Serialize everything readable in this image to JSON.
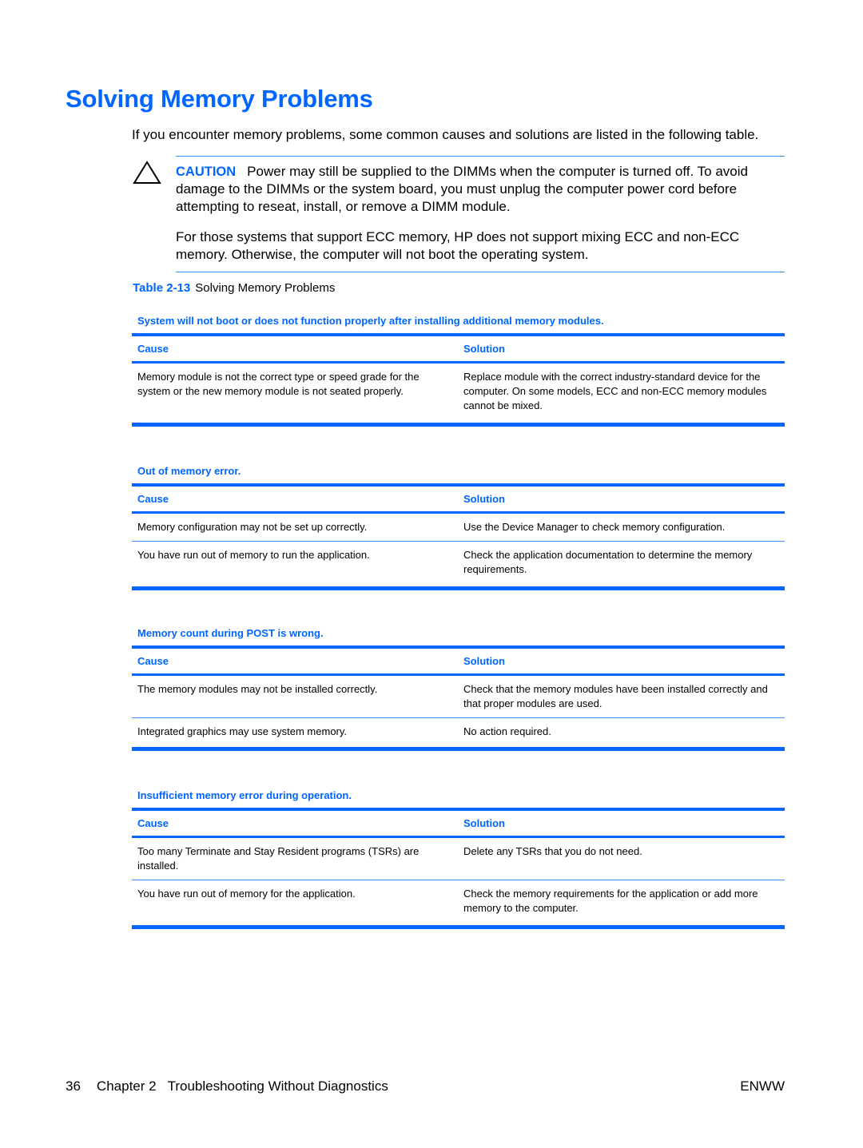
{
  "page_title": "Solving Memory Problems",
  "intro": "If you encounter memory problems, some common causes and solutions are listed in the following table.",
  "caution": {
    "icon": "warning-triangle-icon",
    "label": "CAUTION",
    "text": "Power may still be supplied to the DIMMs when the computer is turned off. To avoid damage to the DIMMs or the system board, you must unplug the computer power cord before attempting to reseat, install, or remove a DIMM module.",
    "note": "For those systems that support ECC memory, HP does not support mixing ECC and non-ECC memory. Otherwise, the computer will not boot the operating system."
  },
  "table_caption": {
    "number": "Table 2-13",
    "title": "Solving Memory Problems"
  },
  "headers": {
    "cause": "Cause",
    "solution": "Solution"
  },
  "issues": [
    {
      "title": "System will not boot or does not function properly after installing additional memory modules.",
      "rows": [
        {
          "cause": "Memory module is not the correct type or speed grade for the system or the new memory module is not seated properly.",
          "solution": "Replace module with the correct industry-standard device for the computer. On some models, ECC and non-ECC memory modules cannot be mixed."
        }
      ]
    },
    {
      "title": "Out of memory error.",
      "rows": [
        {
          "cause": "Memory configuration may not be set up correctly.",
          "solution": "Use the Device Manager to check memory configuration."
        },
        {
          "cause": "You have run out of memory to run the application.",
          "solution": "Check the application documentation to determine the memory requirements."
        }
      ]
    },
    {
      "title": "Memory count during POST is wrong.",
      "rows": [
        {
          "cause": "The memory modules may not be installed correctly.",
          "solution": "Check that the memory modules have been installed correctly and that proper modules are used."
        },
        {
          "cause": "Integrated graphics may use system memory.",
          "solution": "No action required."
        }
      ]
    },
    {
      "title": "Insufficient memory error during operation.",
      "rows": [
        {
          "cause": "Too many Terminate and Stay Resident programs (TSRs) are installed.",
          "solution": "Delete any TSRs that you do not need."
        },
        {
          "cause": "You have run out of memory for the application.",
          "solution": "Check the memory requirements for the application or add more memory to the computer."
        }
      ]
    }
  ],
  "footer": {
    "page_number": "36",
    "chapter": "Chapter 2",
    "chapter_title": "Troubleshooting Without Diagnostics",
    "locale": "ENWW"
  },
  "colors": {
    "accent": "#0066ff",
    "rule_light": "#3d8bff"
  }
}
